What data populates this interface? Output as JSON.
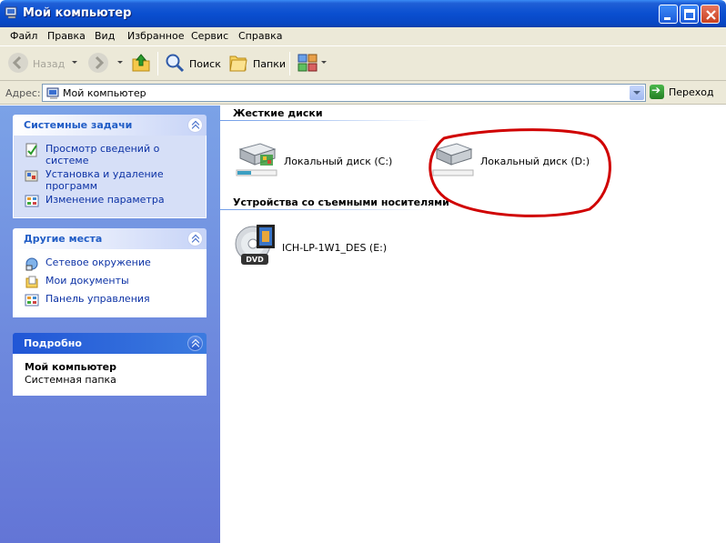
{
  "window": {
    "title": "Мой компьютер",
    "icon": "my-computer-icon"
  },
  "menu": {
    "items": [
      "Файл",
      "Правка",
      "Вид",
      "Избранное",
      "Сервис",
      "Справка"
    ]
  },
  "toolbar": {
    "back_label": "Назад",
    "search_label": "Поиск",
    "folders_label": "Папки"
  },
  "address": {
    "label": "Адрес:",
    "value": "Мой компьютер",
    "go_label": "Переход"
  },
  "sidebar": {
    "system_tasks": {
      "title": "Системные задачи",
      "items": [
        {
          "label": "Просмотр сведений о системе",
          "icon": "system-info-icon"
        },
        {
          "label": "Установка и удаление программ",
          "icon": "add-remove-programs-icon"
        },
        {
          "label": "Изменение параметра",
          "icon": "control-panel-icon"
        }
      ]
    },
    "other_places": {
      "title": "Другие места",
      "items": [
        {
          "label": "Сетевое окружение",
          "icon": "network-places-icon"
        },
        {
          "label": "Мои документы",
          "icon": "my-documents-icon"
        },
        {
          "label": "Панель управления",
          "icon": "control-panel-icon"
        }
      ]
    },
    "details": {
      "title": "Подробно",
      "name": "Мой компьютер",
      "type": "Системная папка"
    }
  },
  "main": {
    "hard_drives": {
      "title": "Жесткие диски",
      "items": [
        {
          "name": "Локальный диск (C:)",
          "icon": "hard-drive-icon",
          "usage": 0.35
        },
        {
          "name": "Локальный диск (D:)",
          "icon": "hard-drive-icon",
          "usage": 0.0
        }
      ]
    },
    "removable": {
      "title": "Устройства со съемными носителями",
      "items": [
        {
          "name": "ICH-LP-1W1_DES (E:)",
          "icon": "dvd-drive-icon"
        }
      ]
    }
  },
  "colors": {
    "titlebar": "#0a4fd0",
    "sidebar": "#7ba2e7",
    "link": "#0c32a5",
    "highlight_circle": "#d00000"
  }
}
